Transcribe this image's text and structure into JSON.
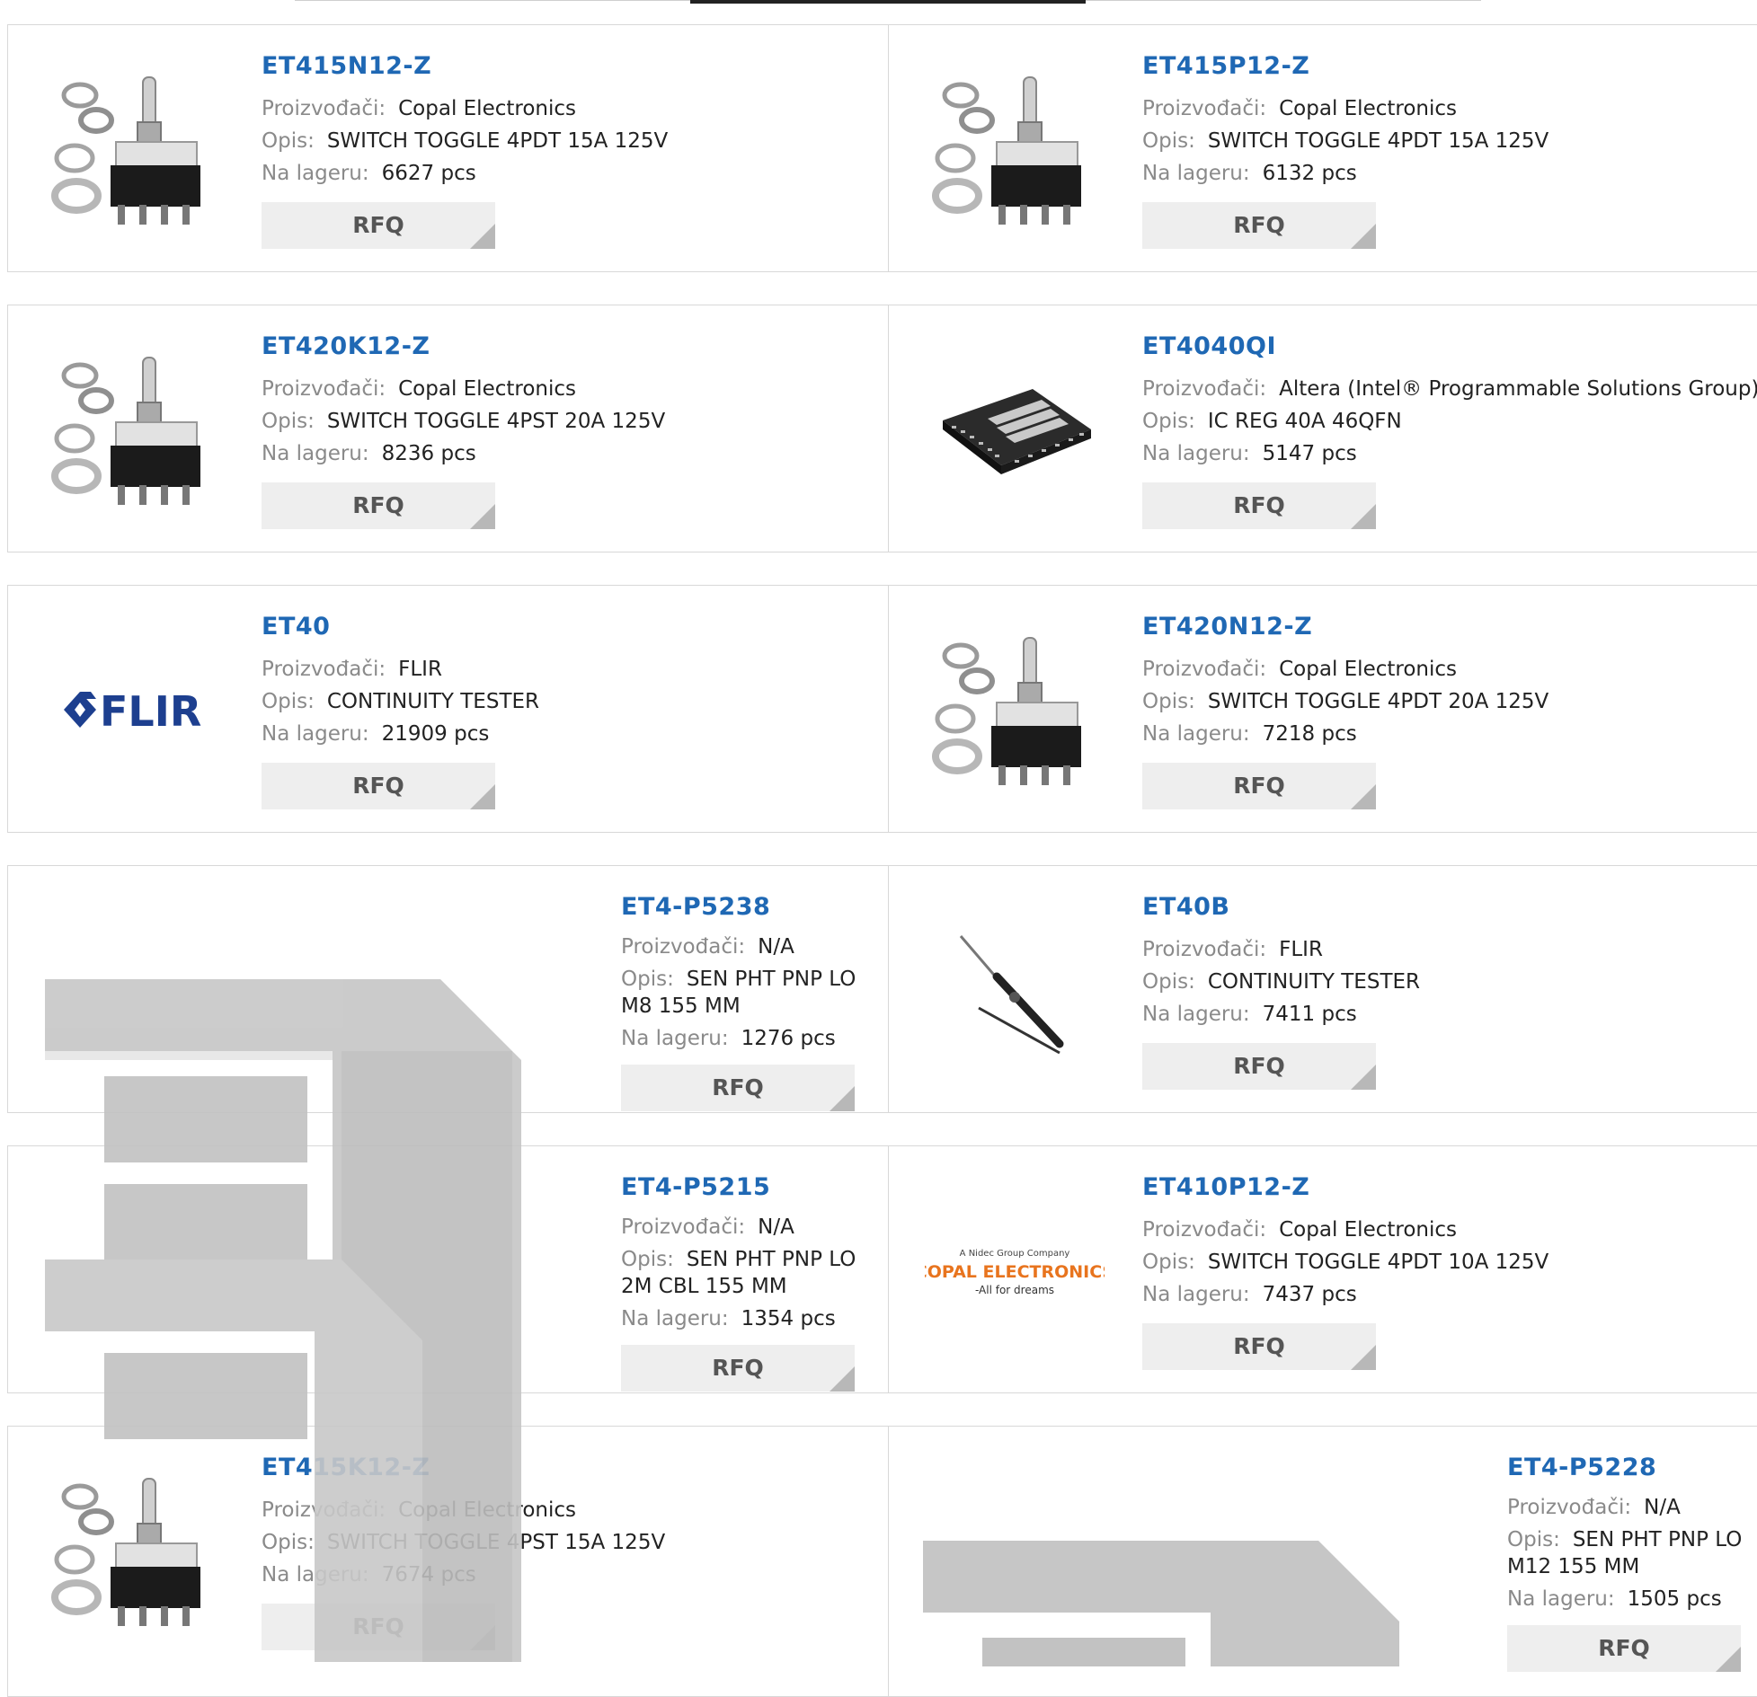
{
  "labels": {
    "manufacturer": "Proizvođači:",
    "description": "Opis:",
    "stock": "Na lageru:",
    "rfq": "RFQ"
  },
  "products": [
    {
      "name": "ET415N12-Z",
      "manufacturer": "Copal Electronics",
      "description": "SWITCH TOGGLE 4PDT 15A 125V",
      "stock": "6627 pcs",
      "image": "toggle-switch-icon"
    },
    {
      "name": "ET415P12-Z",
      "manufacturer": "Copal Electronics",
      "description": "SWITCH TOGGLE 4PDT 15A 125V",
      "stock": "6132 pcs",
      "image": "toggle-switch-icon"
    },
    {
      "name": "ET420K12-Z",
      "manufacturer": "Copal Electronics",
      "description": "SWITCH TOGGLE 4PST 20A 125V",
      "stock": "8236 pcs",
      "image": "toggle-switch-icon"
    },
    {
      "name": "ET4040QI",
      "manufacturer": "Altera (Intel® Programmable Solutions Group)",
      "description": "IC REG 40A 46QFN",
      "stock": "5147 pcs",
      "image": "qfn-chip-icon"
    },
    {
      "name": "ET40",
      "manufacturer": "FLIR",
      "description": "CONTINUITY TESTER",
      "stock": "21909 pcs",
      "image": "flir-logo"
    },
    {
      "name": "ET420N12-Z",
      "manufacturer": "Copal Electronics",
      "description": "SWITCH TOGGLE 4PDT 20A 125V",
      "stock": "7218 pcs",
      "image": "toggle-switch-icon"
    },
    {
      "name": "ET4-P5238",
      "manufacturer": "N/A",
      "description": "SEN PHT PNP LO M8 155 MM",
      "stock": "1276 pcs",
      "image": "placeholder-logo"
    },
    {
      "name": "ET40B",
      "manufacturer": "FLIR",
      "description": "CONTINUITY TESTER",
      "stock": "7411 pcs",
      "image": "tester-probe-icon"
    },
    {
      "name": "ET4-P5215",
      "manufacturer": "N/A",
      "description": "SEN PHT PNP LO 2M CBL 155 MM",
      "stock": "1354 pcs",
      "image": "placeholder-logo"
    },
    {
      "name": "ET410P12-Z",
      "manufacturer": "Copal Electronics",
      "description": "SWITCH TOGGLE 4PDT 10A 125V",
      "stock": "7437 pcs",
      "image": "copal-logo"
    },
    {
      "name": "ET415K12-Z",
      "manufacturer": "Copal Electronics",
      "description": "SWITCH TOGGLE 4PST 15A 125V",
      "stock": "7674 pcs",
      "image": "toggle-switch-icon"
    },
    {
      "name": "ET4-P5228",
      "manufacturer": "N/A",
      "description": "SEN PHT PNP LO M12 155 MM",
      "stock": "1505 pcs",
      "image": "placeholder-logo"
    }
  ],
  "logos": {
    "flir": "FLIR",
    "copal_top": "A Nidec Group Company",
    "copal_main": "COPAL ELECTRONICS",
    "copal_sub": "-All for dreams"
  },
  "colors": {
    "accent": "#1f68b4",
    "label": "#8a8a8a",
    "button_bg": "#eeeeee",
    "copal": "#e8741e"
  }
}
